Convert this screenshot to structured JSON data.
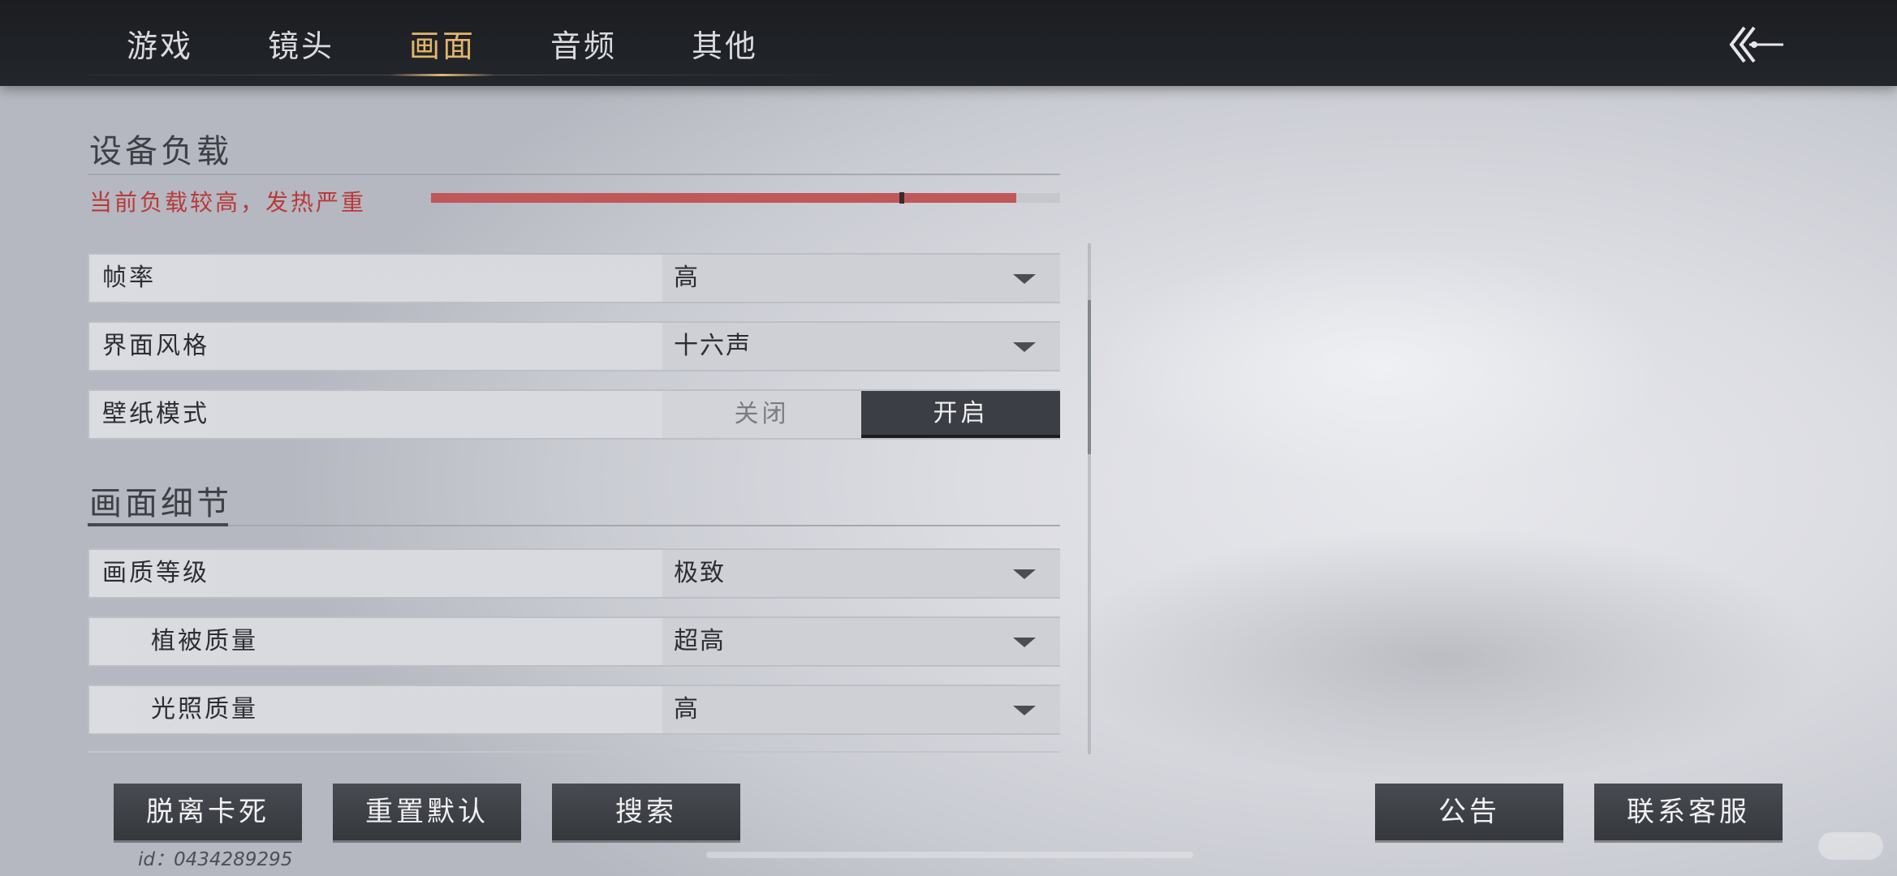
{
  "tabs": [
    {
      "label": "游戏",
      "active": false
    },
    {
      "label": "镜头",
      "active": false
    },
    {
      "label": "画面",
      "active": true
    },
    {
      "label": "音频",
      "active": false
    },
    {
      "label": "其他",
      "active": false
    }
  ],
  "back_icon": "back-arrow-icon",
  "device_load": {
    "title": "设备负载",
    "warning": "当前负载较高，发热严重",
    "load_level": 0.93,
    "marker_level": 0.745,
    "warning_color": "#b9393a"
  },
  "settings": [
    {
      "label": "帧率",
      "value": "高"
    },
    {
      "label": "界面风格",
      "value": "十六声"
    }
  ],
  "wallpaper": {
    "label": "壁纸模式",
    "off_label": "关闭",
    "on_label": "开启",
    "selected": "on"
  },
  "detail": {
    "title": "画面细节",
    "rows": [
      {
        "label": "画质等级",
        "value": "极致"
      },
      {
        "label": "植被质量",
        "value": "超高"
      },
      {
        "label": "光照质量",
        "value": "高"
      }
    ]
  },
  "buttons": {
    "unstuck": "脱离卡死",
    "reset": "重置默认",
    "search": "搜索",
    "notice": "公告",
    "support": "联系客服"
  },
  "player_id": "id：0434289295",
  "accent_color": "#e2b56a"
}
